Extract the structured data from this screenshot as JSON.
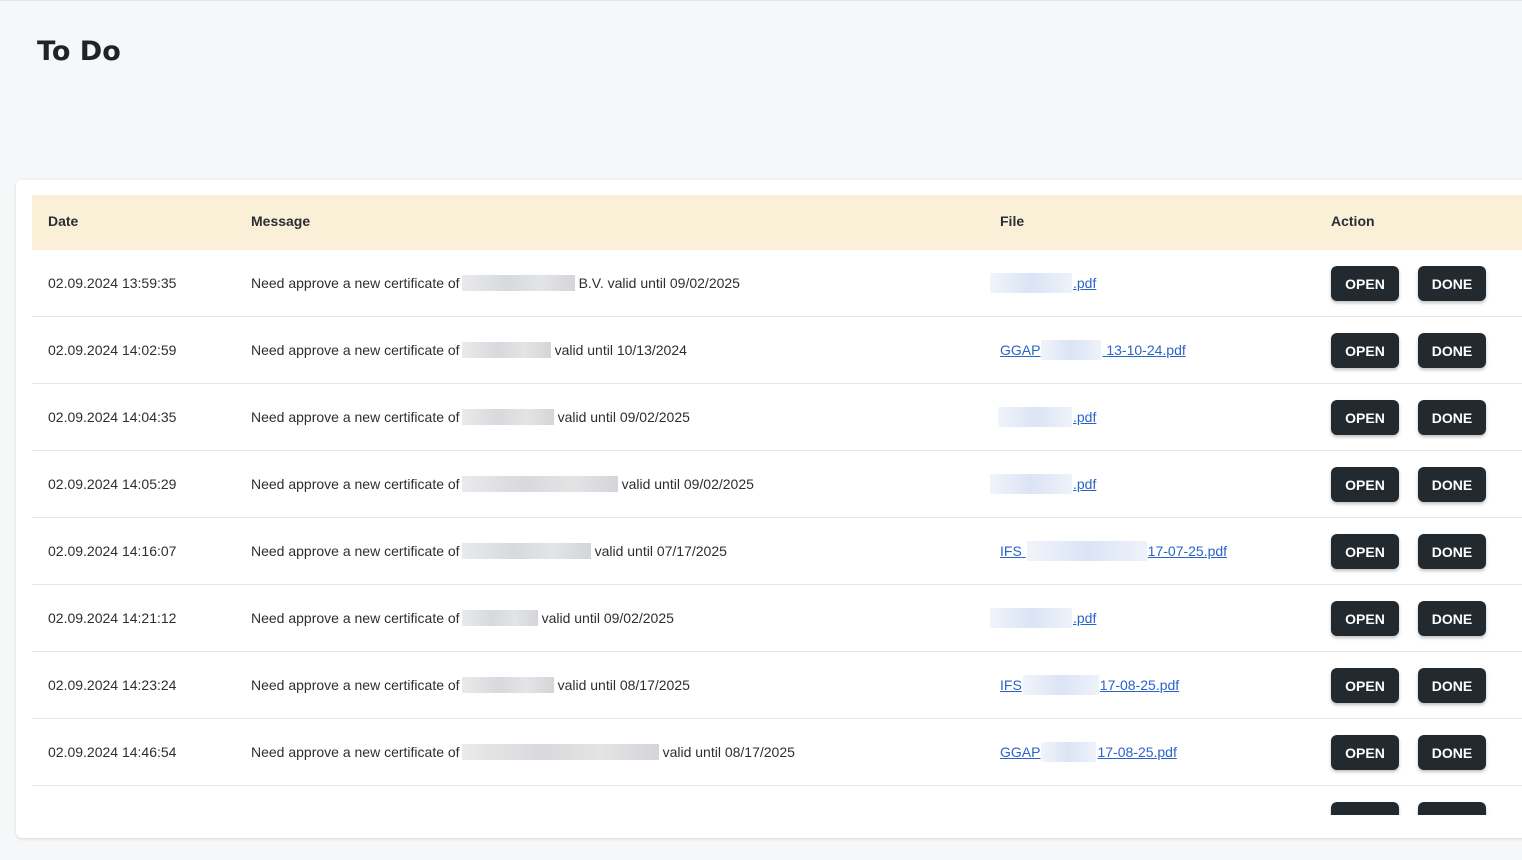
{
  "page": {
    "title": "To Do"
  },
  "table": {
    "columns": {
      "date": "Date",
      "message": "Message",
      "file": "File",
      "action": "Action"
    },
    "open_label": "OPEN",
    "done_label": "DONE",
    "rows": [
      {
        "date": "02.09.2024 14:46:54",
        "msg_prefix": "Need approve a new certificate of",
        "msg_suffix": "valid until 08/17/2025",
        "file_prefix": "GGAP",
        "file_suffix": "17-08-25.pdf"
      },
      {
        "date": "02.09.2024 13:59:35",
        "msg_prefix": "Need approve a new certificate of",
        "msg_suffix": "B.V. valid until 09/02/2025",
        "file_prefix": "",
        "file_suffix": ".pdf"
      },
      {
        "date": "02.09.2024 14:02:59",
        "msg_prefix": "Need approve a new certificate of",
        "msg_suffix": "valid until 10/13/2024",
        "file_prefix": "GGAP",
        "file_suffix": "13-10-24.pdf"
      },
      {
        "date": "02.09.2024 14:04:35",
        "msg_prefix": "Need approve a new certificate of",
        "msg_suffix": "valid until 09/02/2025",
        "file_prefix": "",
        "file_suffix": ".pdf"
      },
      {
        "date": "02.09.2024 14:05:29",
        "msg_prefix": "Need approve a new certificate of",
        "msg_suffix": "valid until 09/02/2025",
        "file_prefix": "",
        "file_suffix": ".pdf"
      },
      {
        "date": "02.09.2024 14:16:07",
        "msg_prefix": "Need approve a new certificate of",
        "msg_suffix": "valid until 07/17/2025",
        "file_prefix": "IFS",
        "file_suffix": "17-07-25.pdf"
      },
      {
        "date": "02.09.2024 14:21:12",
        "msg_prefix": "Need approve a new certificate of",
        "msg_suffix": "valid until 09/02/2025",
        "file_prefix": "",
        "file_suffix": ".pdf"
      },
      {
        "date": "02.09.2024 14:23:24",
        "msg_prefix": "Need approve a new certificate of",
        "msg_suffix": "valid until 08/17/2025",
        "file_prefix": "IFS",
        "file_suffix": "17-08-25.pdf"
      }
    ]
  }
}
